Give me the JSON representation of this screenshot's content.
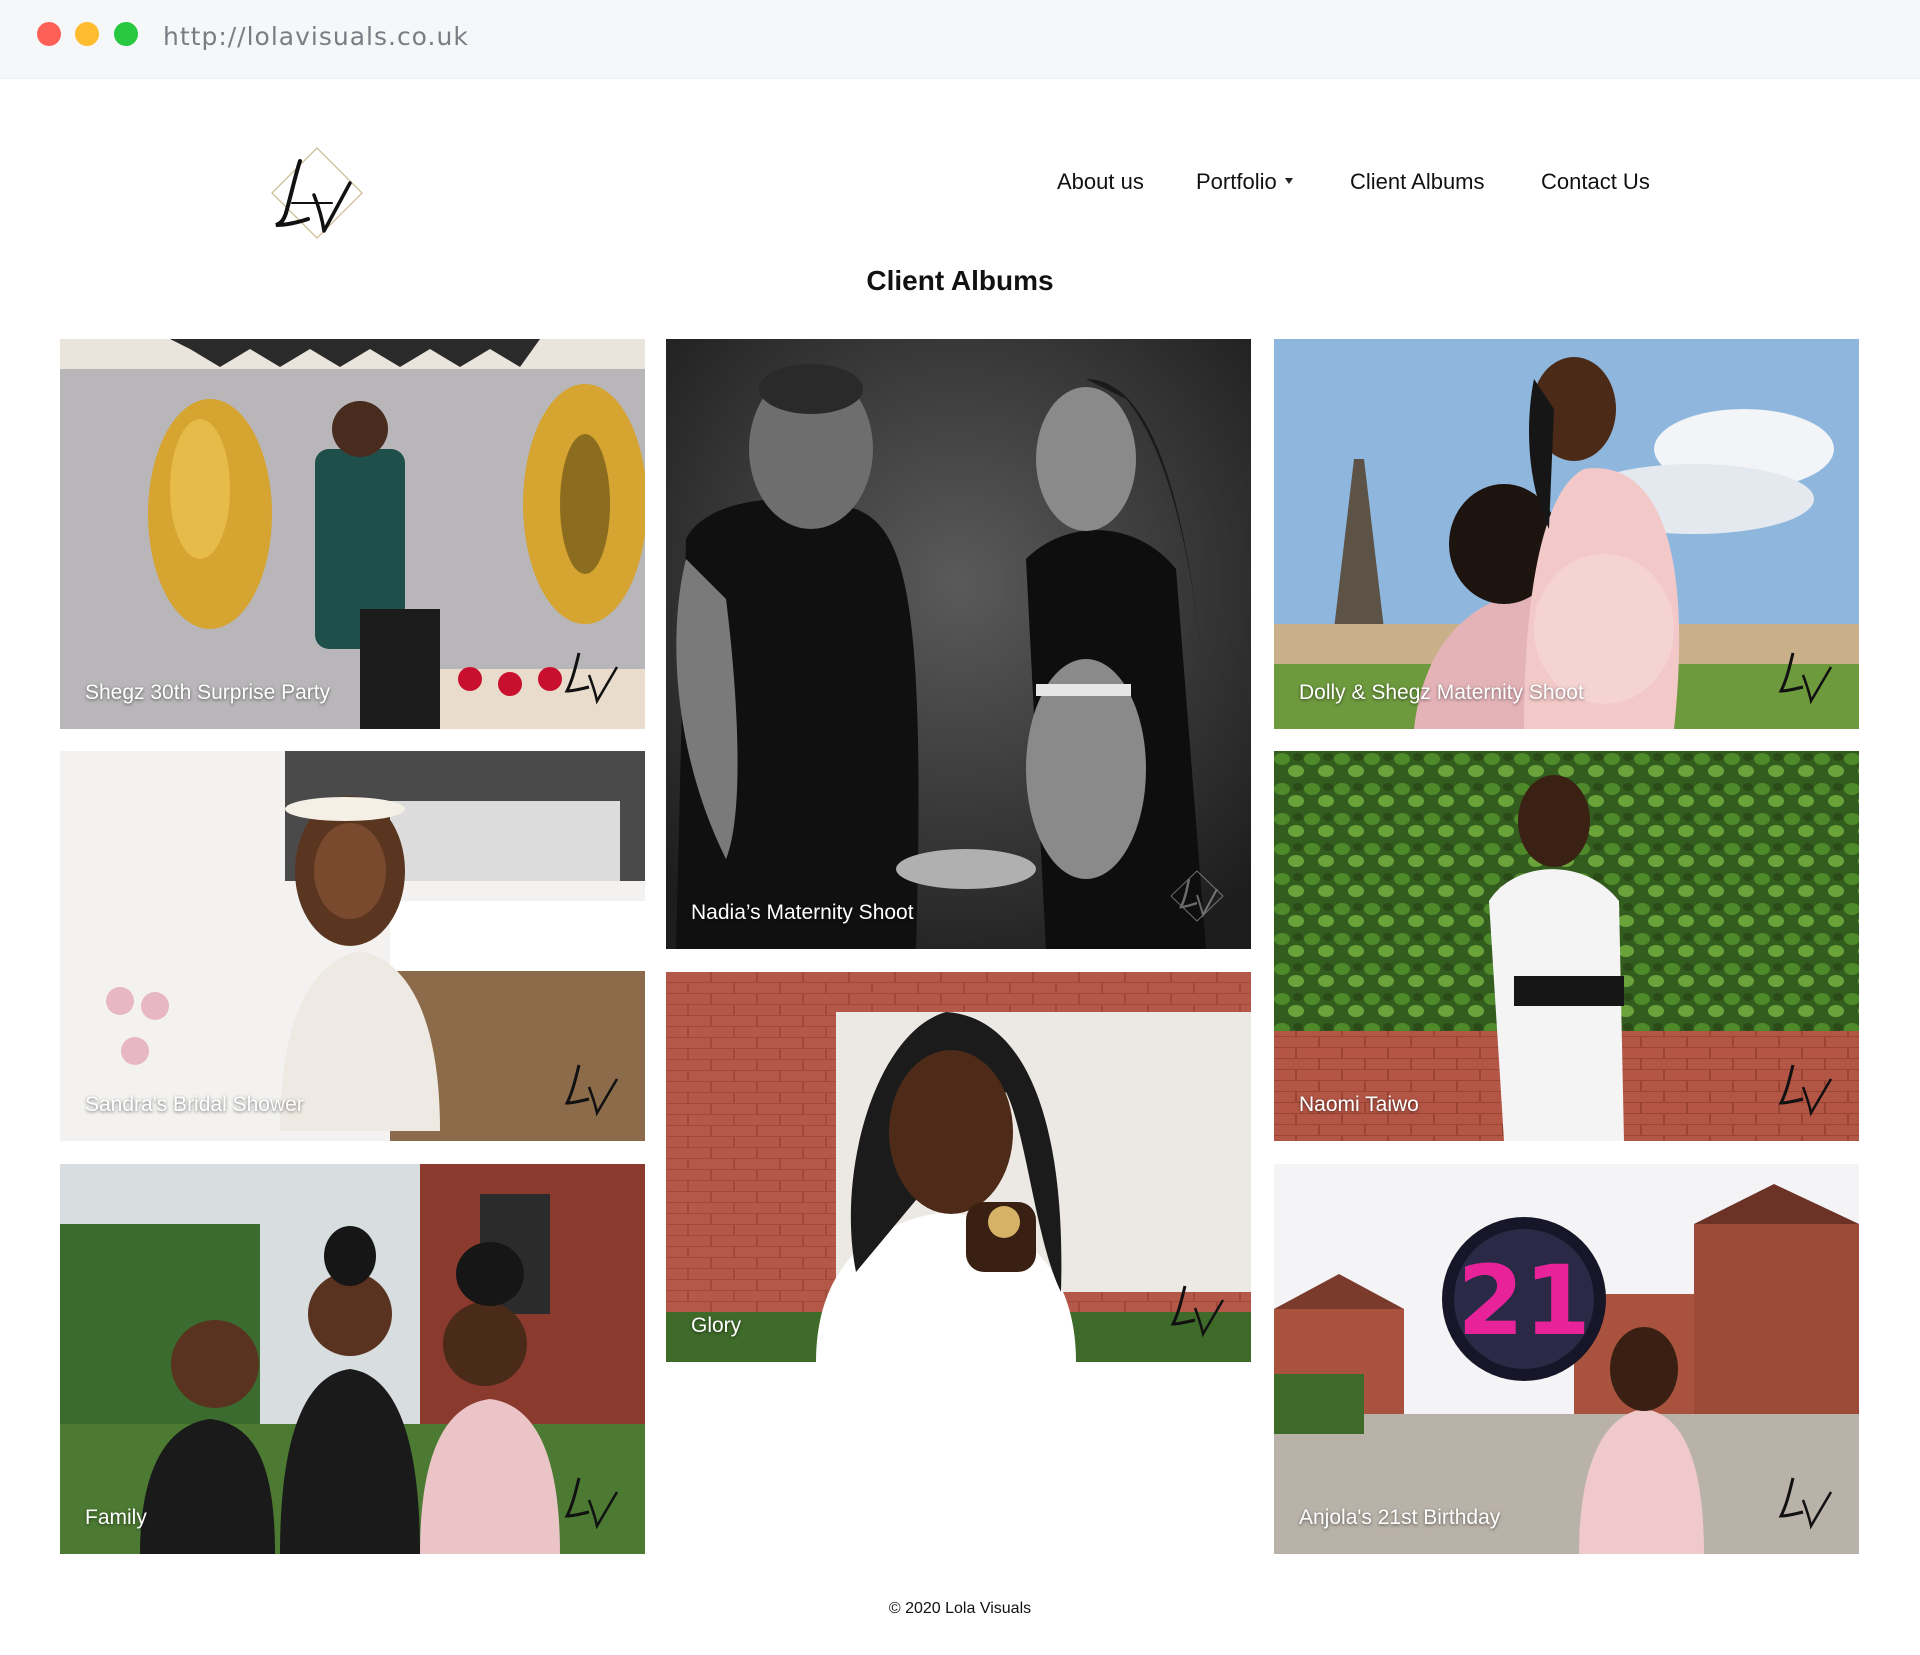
{
  "browser": {
    "url": "http://lolavisuals.co.uk",
    "controls": [
      "close-dot",
      "minimize-dot",
      "maximize-dot"
    ]
  },
  "header": {
    "logo_text": "LV",
    "nav": [
      {
        "label": "About us",
        "has_dropdown": false
      },
      {
        "label": "Portfolio",
        "has_dropdown": true
      },
      {
        "label": "Client Albums",
        "has_dropdown": false
      },
      {
        "label": "Contact Us",
        "has_dropdown": false
      }
    ]
  },
  "page": {
    "title": "Client Albums"
  },
  "albums": [
    {
      "caption": "Shegz 30th Surprise Party"
    },
    {
      "caption": "Sandra's Bridal Shower"
    },
    {
      "caption": "Family"
    },
    {
      "caption": "Nadia’s Maternity Shoot"
    },
    {
      "caption": "Glory"
    },
    {
      "caption": "Dolly & Shegz Maternity Shoot"
    },
    {
      "caption": "Naomi Taiwo"
    },
    {
      "caption": "Anjola's 21st Birthday"
    }
  ],
  "footer": {
    "copyright": "© 2020 Lola Visuals"
  }
}
